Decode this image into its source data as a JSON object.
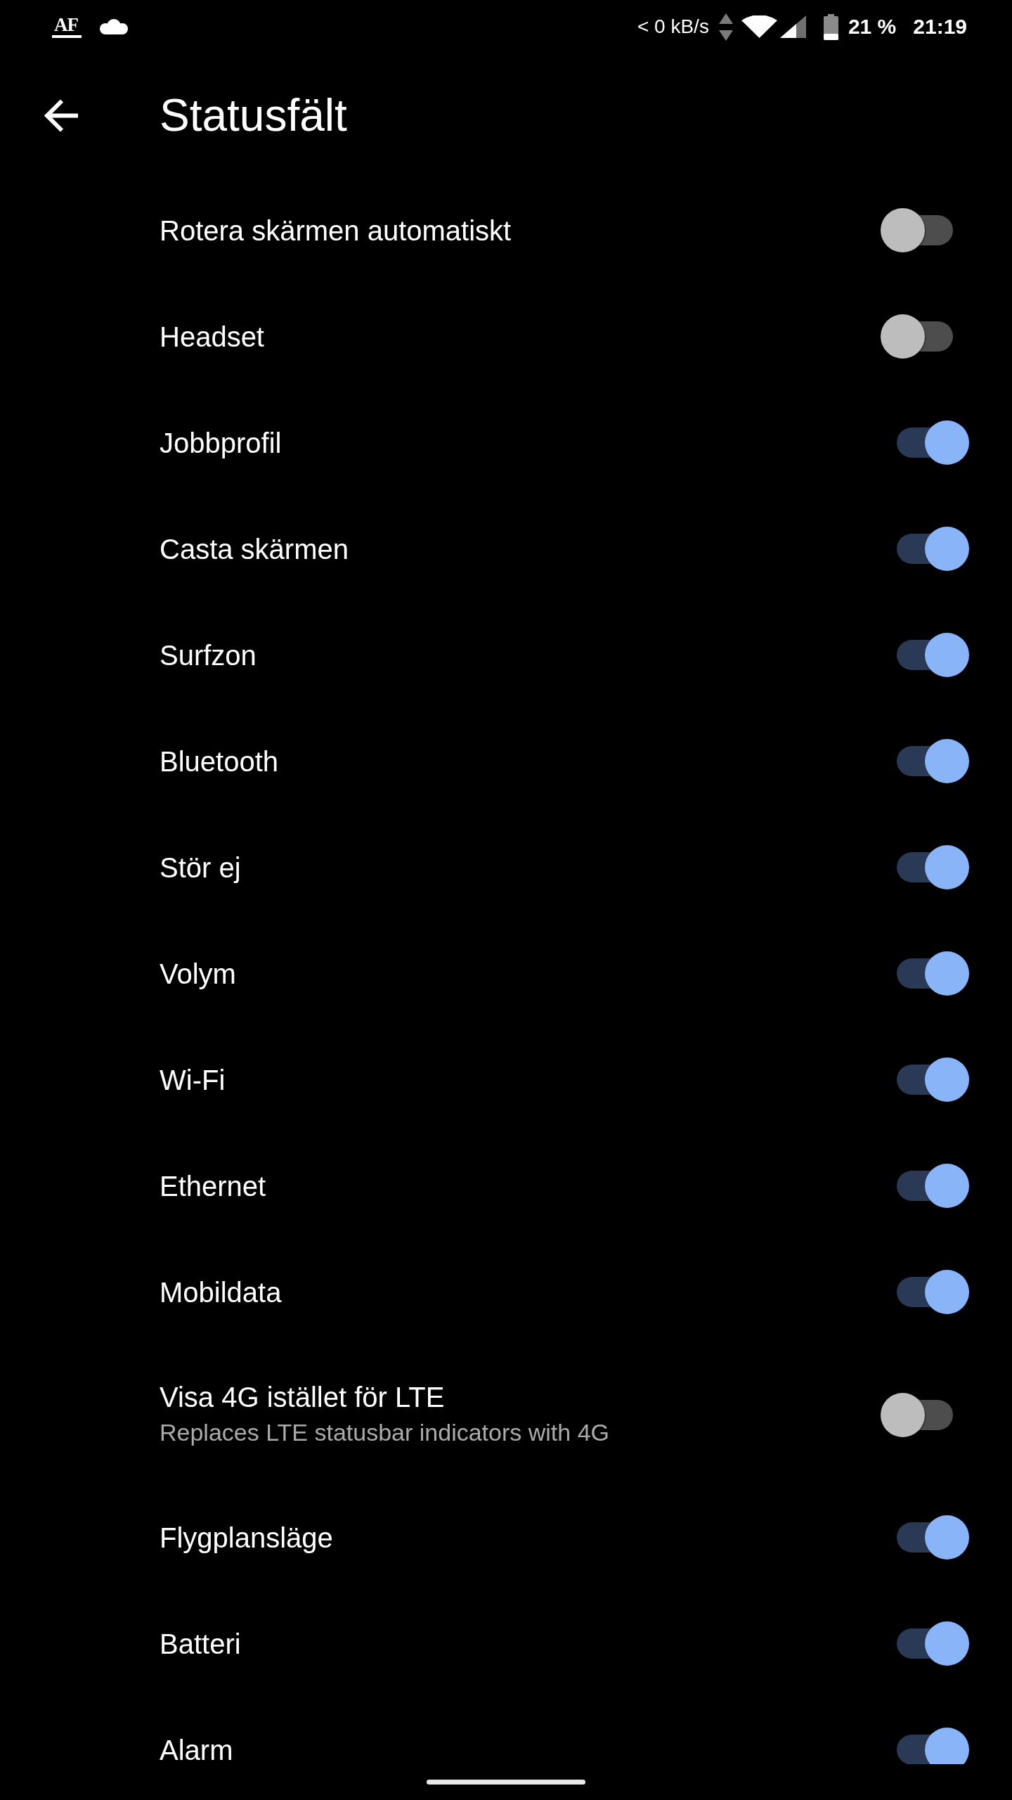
{
  "status_bar": {
    "badge": "AF",
    "network_speed": "< 0 kB/s",
    "battery": "21 %",
    "time": "21:19"
  },
  "toolbar": {
    "title": "Statusfält"
  },
  "items": [
    {
      "label": "Rotera skärmen automatiskt",
      "on": false
    },
    {
      "label": "Headset",
      "on": false
    },
    {
      "label": "Jobbprofil",
      "on": true
    },
    {
      "label": "Casta skärmen",
      "on": true
    },
    {
      "label": "Surfzon",
      "on": true
    },
    {
      "label": "Bluetooth",
      "on": true
    },
    {
      "label": "Stör ej",
      "on": true
    },
    {
      "label": "Volym",
      "on": true
    },
    {
      "label": "Wi-Fi",
      "on": true
    },
    {
      "label": "Ethernet",
      "on": true
    },
    {
      "label": "Mobildata",
      "on": true
    },
    {
      "label": "Visa 4G istället för LTE",
      "summary": "Replaces LTE statusbar indicators with 4G",
      "on": false
    },
    {
      "label": "Flygplansläge",
      "on": true
    },
    {
      "label": "Batteri",
      "on": true
    },
    {
      "label": "Alarm",
      "on": true
    }
  ]
}
